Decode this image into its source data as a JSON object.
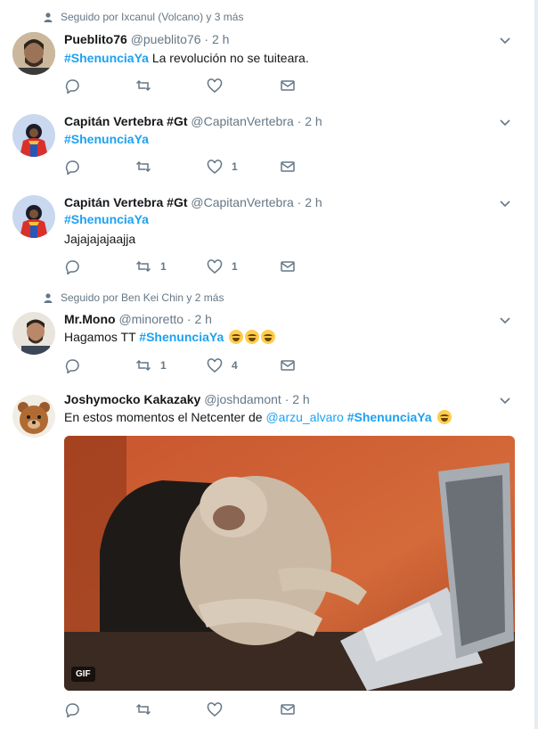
{
  "colors": {
    "link": "#1da1f2",
    "muted": "#657786",
    "border": "#e6ecf0"
  },
  "tweets": [
    {
      "social": "Seguido por Ixcanul (Volcano) y 3 más",
      "name": "Pueblito76",
      "handle": "@pueblito76",
      "dot": "·",
      "time": "2 h",
      "hashtag": "#ShenunciaYa",
      "text": " La revolución no se tuiteara.",
      "replies": "",
      "retweets": "",
      "likes": ""
    },
    {
      "name": "Capitán Vertebra #Gt",
      "handle": "@CapitanVertebra",
      "dot": "·",
      "time": "2 h",
      "hashtag": "#ShenunciaYa",
      "replies": "",
      "retweets": "",
      "likes": "1"
    },
    {
      "name": "Capitán Vertebra #Gt",
      "handle": "@CapitanVertebra",
      "dot": "·",
      "time": "2 h",
      "hashtag": "#ShenunciaYa",
      "text2": "Jajajajajaajja",
      "replies": "",
      "retweets": "1",
      "likes": "1"
    },
    {
      "social": "Seguido por Ben Kei Chin y 2 más",
      "name": "Mr.Mono",
      "handle": "@minoretto",
      "dot": "·",
      "time": "2 h",
      "prefix": "Hagamos TT ",
      "hashtag": "#ShenunciaYa",
      "replies": "",
      "retweets": "1",
      "likes": "4"
    },
    {
      "name": "Joshymocko Kakazaky",
      "handle": "@joshdamont",
      "dot": "·",
      "time": "2 h",
      "prefix": "En estos momentos el Netcenter de ",
      "mention": "@arzu_alvaro",
      "hashtag": "#ShenunciaYa",
      "media_badge": "GIF",
      "replies": "",
      "retweets": "",
      "likes": ""
    }
  ]
}
